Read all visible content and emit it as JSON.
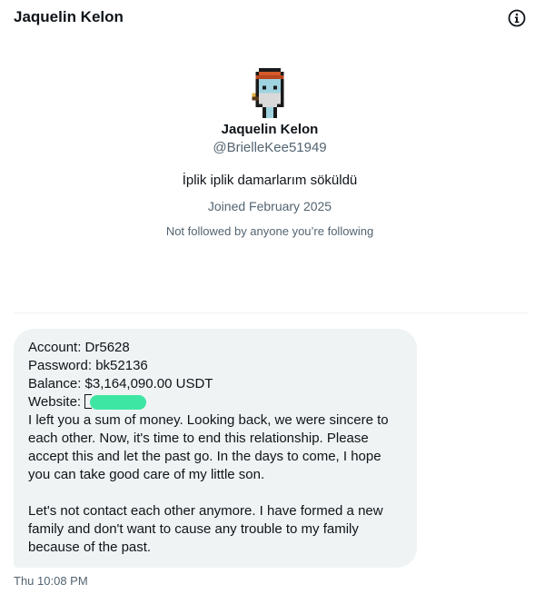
{
  "header": {
    "title": "Jaquelin Kelon",
    "info_icon": "info-icon"
  },
  "profile": {
    "avatar_icon": "pixel-art-avatar",
    "name": "Jaquelin Kelon",
    "handle": "@BrielleKee51949",
    "bio": "İplik iplik damarlarım söküldü",
    "joined": "Joined February 2025",
    "followed_by": "Not followed by anyone you’re following"
  },
  "message": {
    "account_line": "Account: Dr5628",
    "password_line": "Password: bk52136",
    "balance_line": "Balance: $3,164,090.00 USDT",
    "website_label": "Website: ",
    "body_1": "I left you a sum of money. Looking back, we were sincere to each other. Now, it's time to end this relationship. Please accept this and let the past go. In the days to come, I hope you can take good care of my little son.",
    "body_2": "Let's not contact each other anymore. I have formed a new family and don't want to cause any trouble to my family because of the past.",
    "timestamp": "Thu 10:08 PM"
  },
  "colors": {
    "text_primary": "#0f1419",
    "text_secondary": "#536471",
    "bubble_bg": "#eff3f4",
    "redaction_mark": "#3ee6a3"
  }
}
